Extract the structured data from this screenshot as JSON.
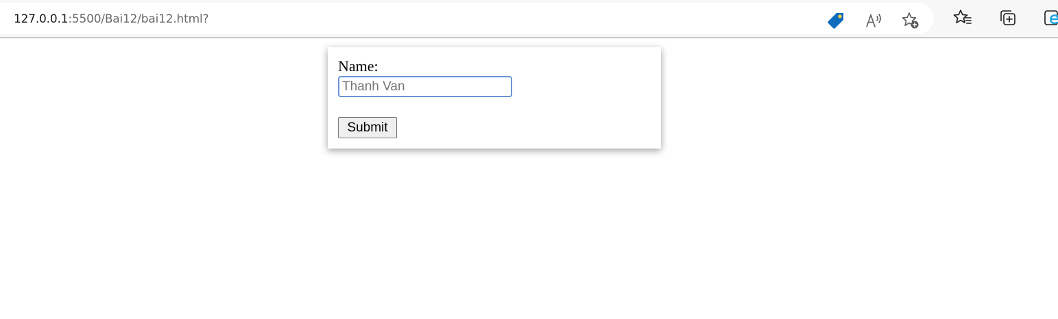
{
  "browser": {
    "url_host": "127.0.0.1",
    "url_rest": ":5500/Bai12/bai12.html?",
    "icons": [
      "price-tag-icon",
      "read-aloud-icon",
      "add-favorite-icon",
      "favorites-icon",
      "collections-icon",
      "internet-explorer-icon"
    ],
    "colors": {
      "tag_blue": "#0f6cbd",
      "tag_dot": "#ffd33d",
      "ie_blue": "#1da1e3"
    }
  },
  "form": {
    "name_label": "Name:",
    "name_placeholder": "Thanh Van",
    "name_value": "",
    "submit_label": "Submit",
    "colors": {
      "input_focus_border": "#6a94d6"
    }
  }
}
